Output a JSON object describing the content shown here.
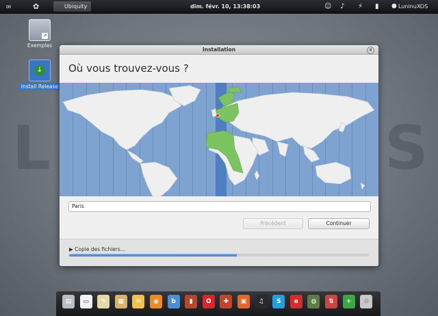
{
  "top_panel": {
    "app_name": "Ubiquity",
    "datetime": "dim. févr. 10, 13:38:03",
    "user_name": "LuninuXOS"
  },
  "desktop": {
    "icons": [
      {
        "label": "Exemples",
        "icon": "folder-icon"
      },
      {
        "label": "Install Release",
        "icon": "install-icon"
      }
    ]
  },
  "window": {
    "title": "Installation",
    "heading": "Où vous trouvez-vous ?",
    "city_value": "Paris",
    "back_label": "Précédent",
    "continue_label": "Continuer",
    "progress_label": "▶ Copie des fichiers…",
    "progress": 0.56
  },
  "colors": {
    "ocean": "#7fa3d0",
    "land": "#efefef",
    "selected_region": "#7cc462",
    "timezone_band": "#4f7fc3",
    "progress_fill": "#3b7dd1"
  },
  "dock": {
    "icons": [
      "nautilus-icon",
      "document-icon",
      "text-editor-icon",
      "notes-icon",
      "stickies-icon",
      "rss-icon",
      "social-icon",
      "book-icon",
      "opera-icon",
      "puzzle-icon",
      "image-viewer-icon",
      "microphone-icon",
      "skype-icon",
      "ie-icon",
      "globe-icon",
      "network-icon",
      "add-icon",
      "trash-icon"
    ]
  }
}
